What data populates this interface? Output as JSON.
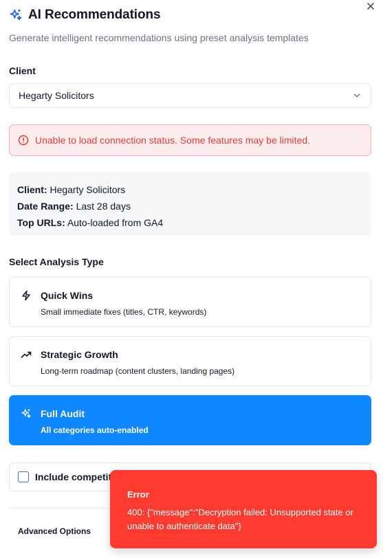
{
  "dialog": {
    "title": "AI Recommendations",
    "subtitle": "Generate intelligent recommendations using preset analysis templates"
  },
  "client": {
    "label": "Client",
    "selected": "Hegarty Solicitors"
  },
  "alert": {
    "message": "Unable to load connection status. Some features may be limited."
  },
  "info": {
    "client_label": "Client:",
    "client_value": "Hegarty Solicitors",
    "date_label": "Date Range:",
    "date_value": "Last 28 days",
    "urls_label": "Top URLs:",
    "urls_value": "Auto-loaded from GA4"
  },
  "analysis": {
    "label": "Select Analysis Type",
    "options": [
      {
        "name": "Quick Wins",
        "description": "Small immediate fixes (titles, CTR, keywords)",
        "icon": "lightning-icon",
        "selected": false
      },
      {
        "name": "Strategic Growth",
        "description": "Long-term roadmap (content clusters, landing pages)",
        "icon": "trending-up-icon",
        "selected": false
      },
      {
        "name": "Full Audit",
        "description": "All categories auto-enabled",
        "icon": "sparkles-icon",
        "selected": true
      }
    ]
  },
  "competitor": {
    "label": "Include competitor",
    "checked": false
  },
  "advanced": {
    "label": "Advanced Options"
  },
  "toast": {
    "title": "Error",
    "message": "400: {\"message\":\"Decryption failed: Unsupported state or unable to authenticate data\"}"
  },
  "colors": {
    "accent": "#0f87ff",
    "error": "#ff3b30",
    "alert_text": "#e53935",
    "alert_bg": "#fdecec"
  }
}
